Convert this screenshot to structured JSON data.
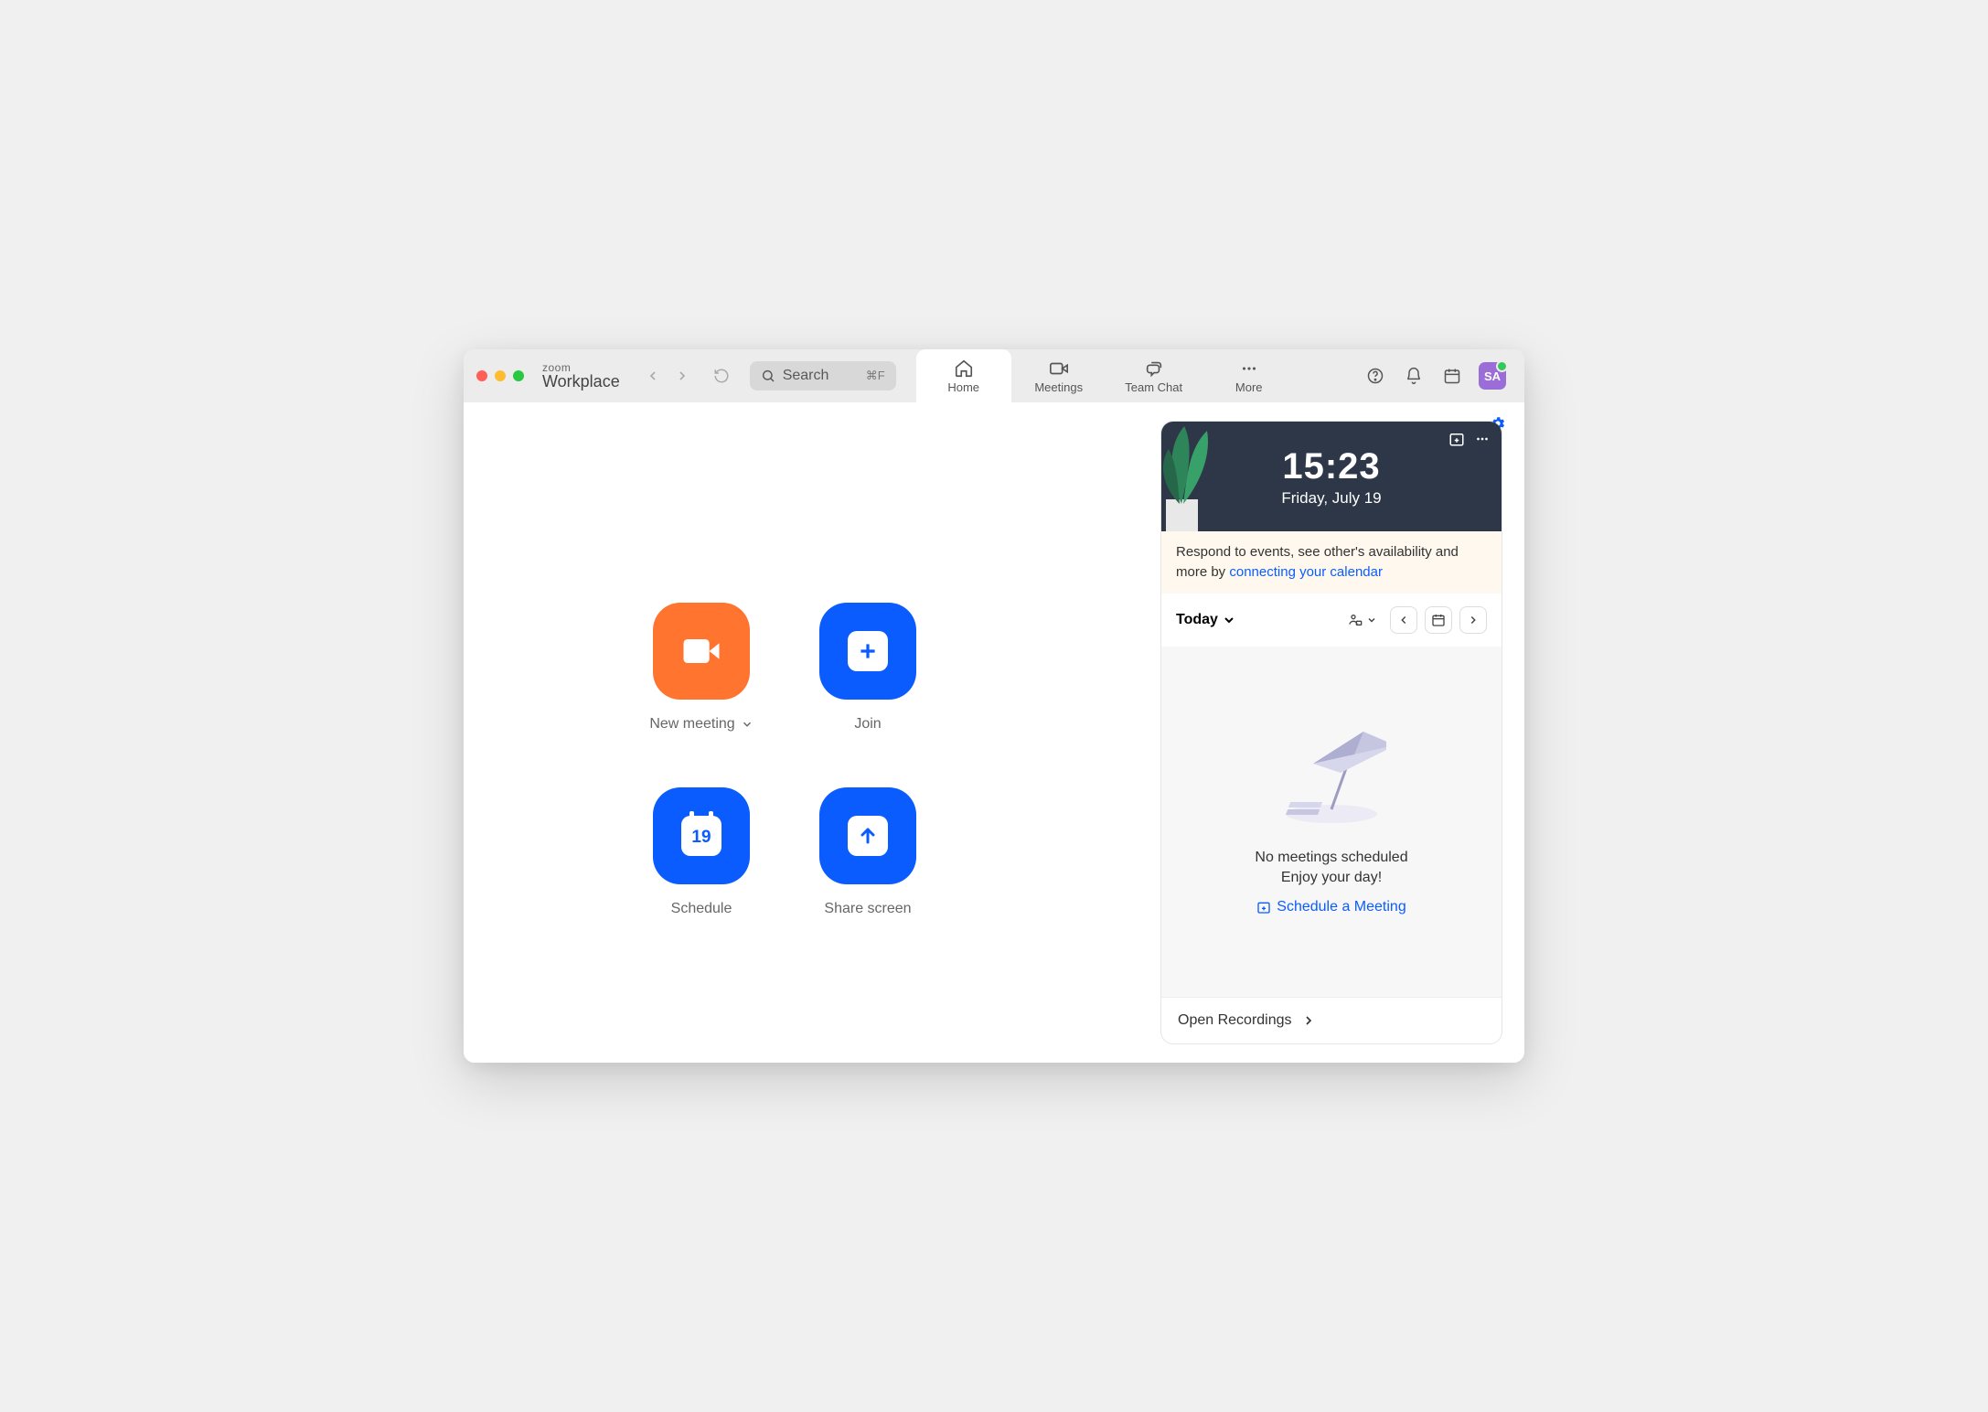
{
  "app": {
    "line1": "zoom",
    "line2": "Workplace"
  },
  "search": {
    "placeholder": "Search",
    "shortcut": "⌘F"
  },
  "tabs": {
    "home": "Home",
    "meetings": "Meetings",
    "teamchat": "Team Chat",
    "more": "More"
  },
  "avatar": {
    "initials": "SA"
  },
  "actions": {
    "new_meeting": "New meeting",
    "join": "Join",
    "schedule": "Schedule",
    "schedule_day": "19",
    "share_screen": "Share screen"
  },
  "clock": {
    "time": "15:23",
    "date": "Friday, July 19"
  },
  "banner": {
    "text": "Respond to events, see other's availability and more by ",
    "link": "connecting your calendar"
  },
  "agenda": {
    "today": "Today"
  },
  "empty": {
    "line1": "No meetings scheduled",
    "line2": "Enjoy your day!",
    "schedule_link": "Schedule a Meeting"
  },
  "recordings": {
    "label": "Open Recordings"
  }
}
